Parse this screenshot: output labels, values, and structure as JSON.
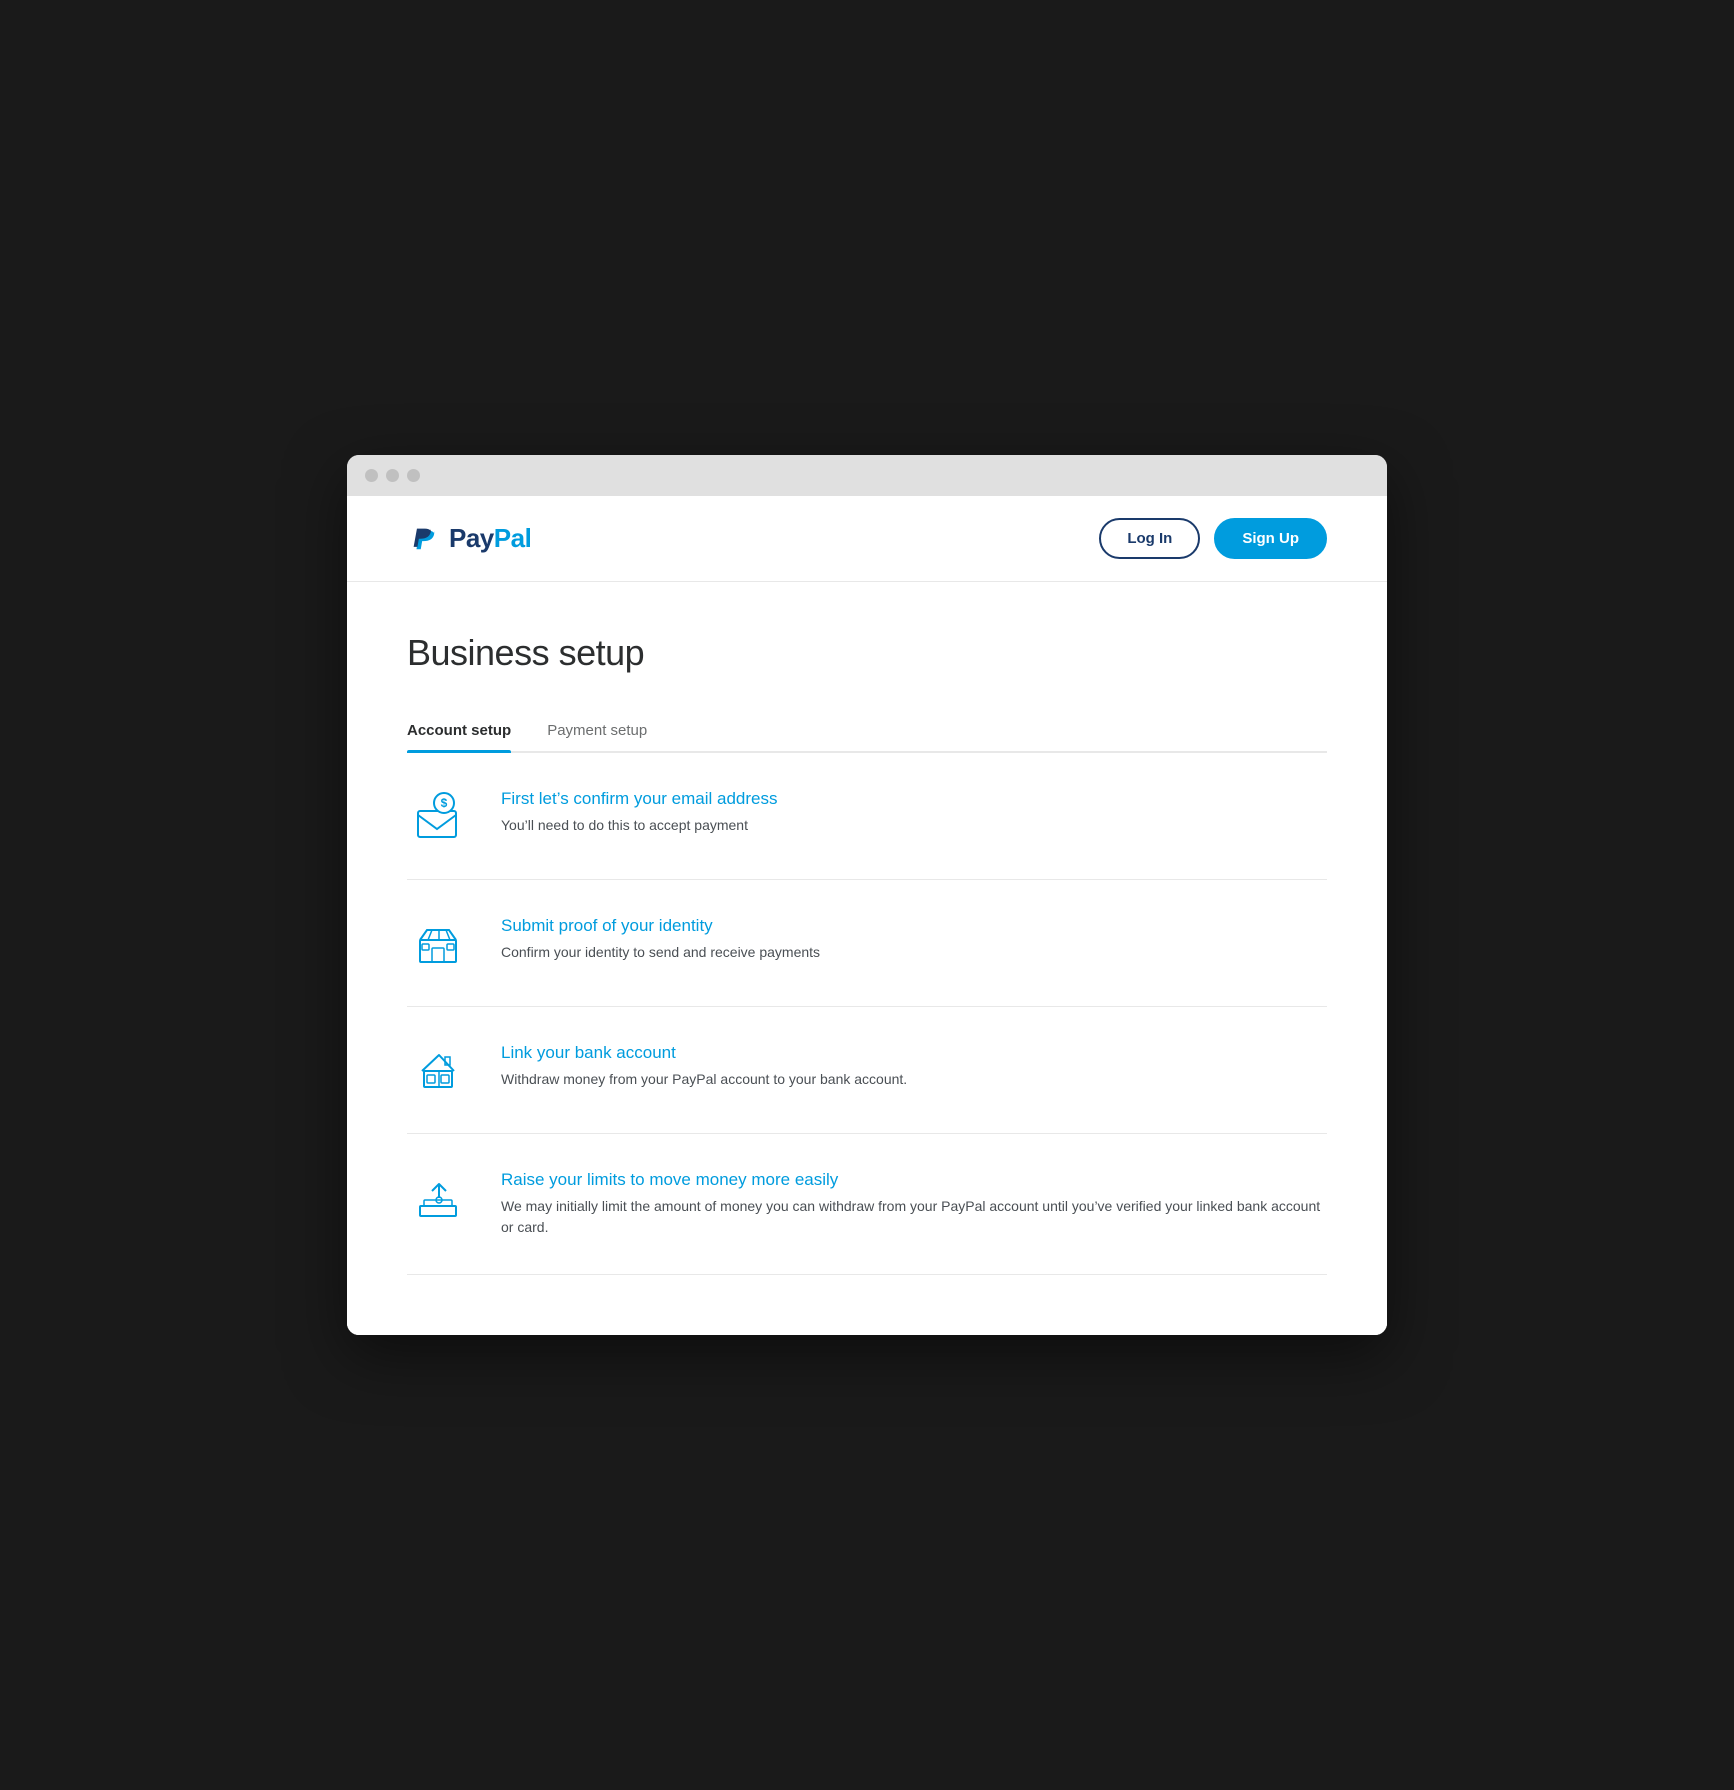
{
  "browser": {
    "dots": [
      "dot1",
      "dot2",
      "dot3"
    ]
  },
  "header": {
    "logo_pay": "Pay",
    "logo_pal": "Pal",
    "login_label": "Log In",
    "signup_label": "Sign Up"
  },
  "page": {
    "title": "Business setup"
  },
  "tabs": [
    {
      "id": "account-setup",
      "label": "Account setup",
      "active": true
    },
    {
      "id": "payment-setup",
      "label": "Payment setup",
      "active": false
    }
  ],
  "setup_items": [
    {
      "id": "confirm-email",
      "icon": "email-icon",
      "title": "First let’s confirm your email address",
      "description": "You’ll need to do this to accept payment"
    },
    {
      "id": "submit-identity",
      "icon": "store-icon",
      "title": "Submit proof of your identity",
      "description": "Confirm your identity to send and receive payments"
    },
    {
      "id": "link-bank",
      "icon": "bank-icon",
      "title": "Link your bank account",
      "description": "Withdraw money from your PayPal account to your bank account."
    },
    {
      "id": "raise-limits",
      "icon": "limits-icon",
      "title": "Raise your limits to move money more easily",
      "description": "We may initially limit the amount of money you can withdraw from your PayPal account until you’ve verified your linked bank account or card."
    }
  ],
  "colors": {
    "paypal_blue": "#1a3a6b",
    "paypal_cyan": "#009cde",
    "text_dark": "#2c2e2f",
    "text_gray": "#4a4f54"
  }
}
